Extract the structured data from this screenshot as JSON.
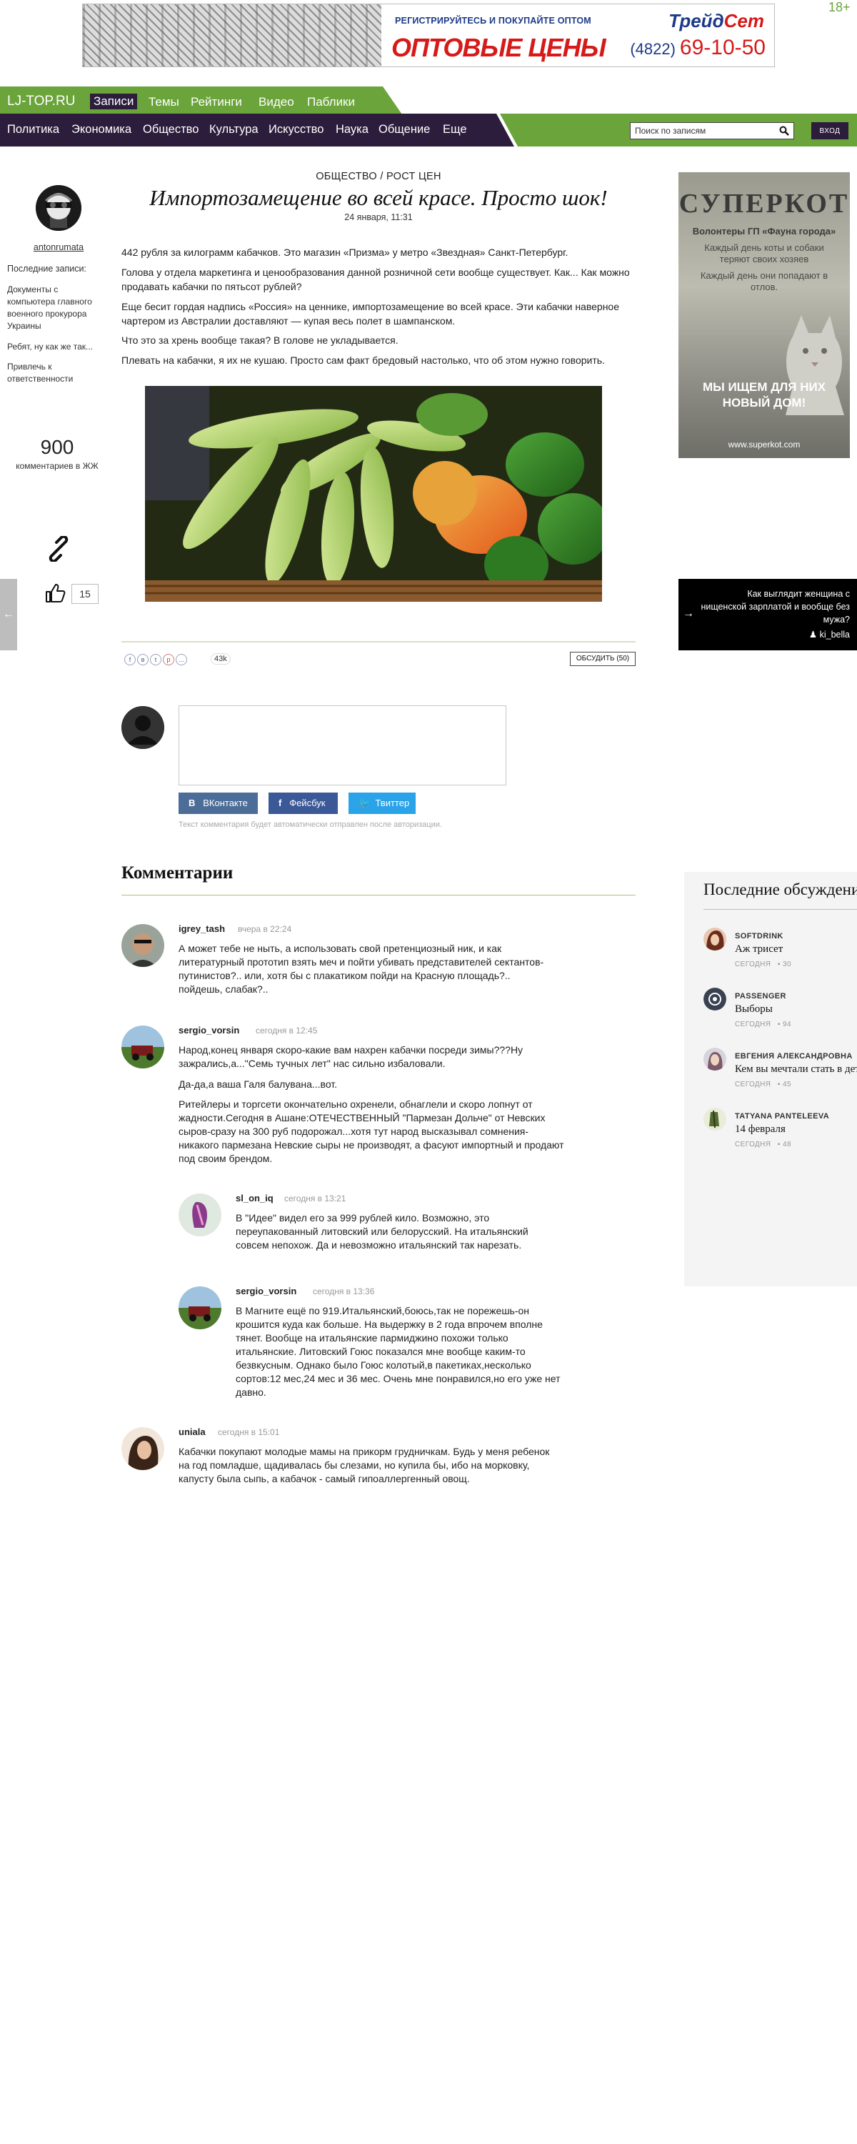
{
  "banner": {
    "register_text": "РЕГИСТРИРУЙТЕСЬ И ПОКУПАЙТЕ ОПТОМ",
    "headline": "ОПТОВЫЕ ЦЕНЫ",
    "brand_part1": "Трейд",
    "brand_part2": "Сет",
    "phone_code": "(4822)",
    "phone": "69-10-50",
    "age": "18+"
  },
  "nav_main": {
    "logo": "LJ-TOP.RU",
    "items": [
      "Записи",
      "Темы",
      "Рейтинги",
      "Видео",
      "Паблики"
    ],
    "active": "Записи",
    "accent_green": "#6aa43a",
    "accent_purple": "#2b1d3b"
  },
  "nav_sections": {
    "items": [
      "Политика",
      "Экономика",
      "Общество",
      "Культура",
      "Искусство",
      "Наука",
      "Общение",
      "Еще"
    ]
  },
  "search": {
    "placeholder": "Поиск по записям",
    "login_label": "ВХОД"
  },
  "author": {
    "name": "antonrumata",
    "recent_label": "Последние записи:",
    "recent_posts": [
      "Документы с компьютера главного военного прокурора Украины",
      "Ребят, ну как же так...",
      "Привлечь к ответственности"
    ],
    "stat_count": "900",
    "stat_label": "комментариев в ЖЖ",
    "likes": "15"
  },
  "article": {
    "category": "ОБЩЕСТВО / РОСТ ЦЕН",
    "title": "Импортозамещение во всей красе. Просто шок!",
    "date": "24 января, 11:31",
    "paragraphs": [
      "442 рубля за килограмм кабачков. Это магазин «Призма» у метро «Звездная» Санкт-Петербург.",
      "Голова у отдела маркетинга и ценообразования данной розничной сети вообще существует. Как... Как можно продавать кабачки по пятьсот рублей?",
      "Еще бесит гордая надпись «Россия» на ценнике, импортозамещение во всей красе. Эти кабачки наверное чартером из Австралии доставляют — купая весь полет в шампанском.",
      "Что это за хрень вообще такая? В голове не укладывается.",
      "Плевать на кабачки, я их не кушаю. Просто сам факт бредовый настолько, что об этом нужно говорить."
    ],
    "share_count": "43k",
    "discuss_label": "ОБСУДИТЬ (50)"
  },
  "comment_form": {
    "vk_label": "ВКонтакте",
    "fb_label": "Фейсбук",
    "tw_label": "Твиттер",
    "note": "Текст комментария будет автоматически отправлен после авторизации."
  },
  "comments": {
    "heading": "Комментарии",
    "items": [
      {
        "user": "igrey_tash",
        "time": "вчера в 22:24",
        "text": [
          "А может тебе не ныть, а использовать свой претенциозный ник, и как литературный прототип взять меч и пойти убивать представителей сектантов-путинистов?.. или, хотя бы с плакатиком пойди на Красную площадь?.. пойдешь, слабак?.."
        ]
      },
      {
        "user": "sergio_vorsin",
        "time": "сегодня в 12:45",
        "text": [
          "Народ,конец января скоро-какие вам нахрен кабачки посреди зимы???Ну зажрались,а...\"Семь тучных лет\" нас сильно избаловали.",
          "Да-да,а ваша Галя балувана...вот.",
          "Ритейлеры и торгсети окончательно охренели, обнаглели и скоро лопнут от жадности.Сегодня в Ашане:ОТЕЧЕСТВЕННЫЙ \"Пармезан Дольче\" от Невских сыров-сразу на 300 руб подорожал...хотя тут народ высказывал сомнения-никакого пармезана Невские сыры не производят, а фасуют импортный и продают под своим брендом."
        ]
      },
      {
        "user": "sl_on_iq",
        "time": "сегодня в 13:21",
        "text": [
          "В \"Идее\" видел его за 999 рублей кило. Возможно, это переупакованный литовский или белорусский. На итальянский совсем непохож. Да и невозможно итальянский так нарезать."
        ]
      },
      {
        "user": "sergio_vorsin",
        "time": "сегодня в 13:36",
        "text": [
          "В Магните ещё по 919.Итальянский,боюсь,так не порежешь-он крошится куда как больше. На выдержку в 2 года впрочем вполне тянет. Вообще на итальянские пармиджино похожи только итальянские. Литовский Гоюс показался мне вообще каким-то безвкусным. Однако было Гоюс колотый,в пакетиках,несколько сортов:12 мес,24 мес и 36 мес. Очень мне понравился,но его уже нет давно."
        ]
      },
      {
        "user": "uniala",
        "time": "сегодня в 15:01",
        "text": [
          "Кабачки покупают молодые мамы на прикорм грудничкам. Будь у меня ребенок на год помладше, щадивалась бы слезами, но купила бы, ибо на морковку, капусту была сыпь, а кабачок - самый гипоаллергенный овощ."
        ]
      }
    ]
  },
  "ad_superkot": {
    "title": "СУПЕРКОТ",
    "subtitle": "Волонтеры ГП «Фауна города»",
    "line1": "Каждый день коты и собаки теряют своих хозяев",
    "line2": "Каждый день они попадают в отлов.",
    "cta": "МЫ ИЩЕМ ДЛЯ НИХ НОВЫЙ ДОМ!",
    "url": "www.superkot.com"
  },
  "promo": {
    "text": "Как выглядит женщина с нищенской зарплатой и вообще без мужа?",
    "author": "ki_bella"
  },
  "discussions": {
    "title": "Последние обсуждения",
    "items": [
      {
        "user": "SOFTDRINK",
        "title": "Аж трисет",
        "date": "СЕГОДНЯ",
        "count": "30"
      },
      {
        "user": "PASSENGER",
        "title": "Выборы",
        "date": "СЕГОДНЯ",
        "count": "94"
      },
      {
        "user": "ЕВГЕНИЯ АЛЕКСАНДРОВНА",
        "title": "Кем вы мечтали стать в дет",
        "date": "СЕГОДНЯ",
        "count": "45"
      },
      {
        "user": "TATYANA PANTELEEVA",
        "title": "14 февраля",
        "date": "СЕГОДНЯ",
        "count": "48"
      }
    ]
  }
}
